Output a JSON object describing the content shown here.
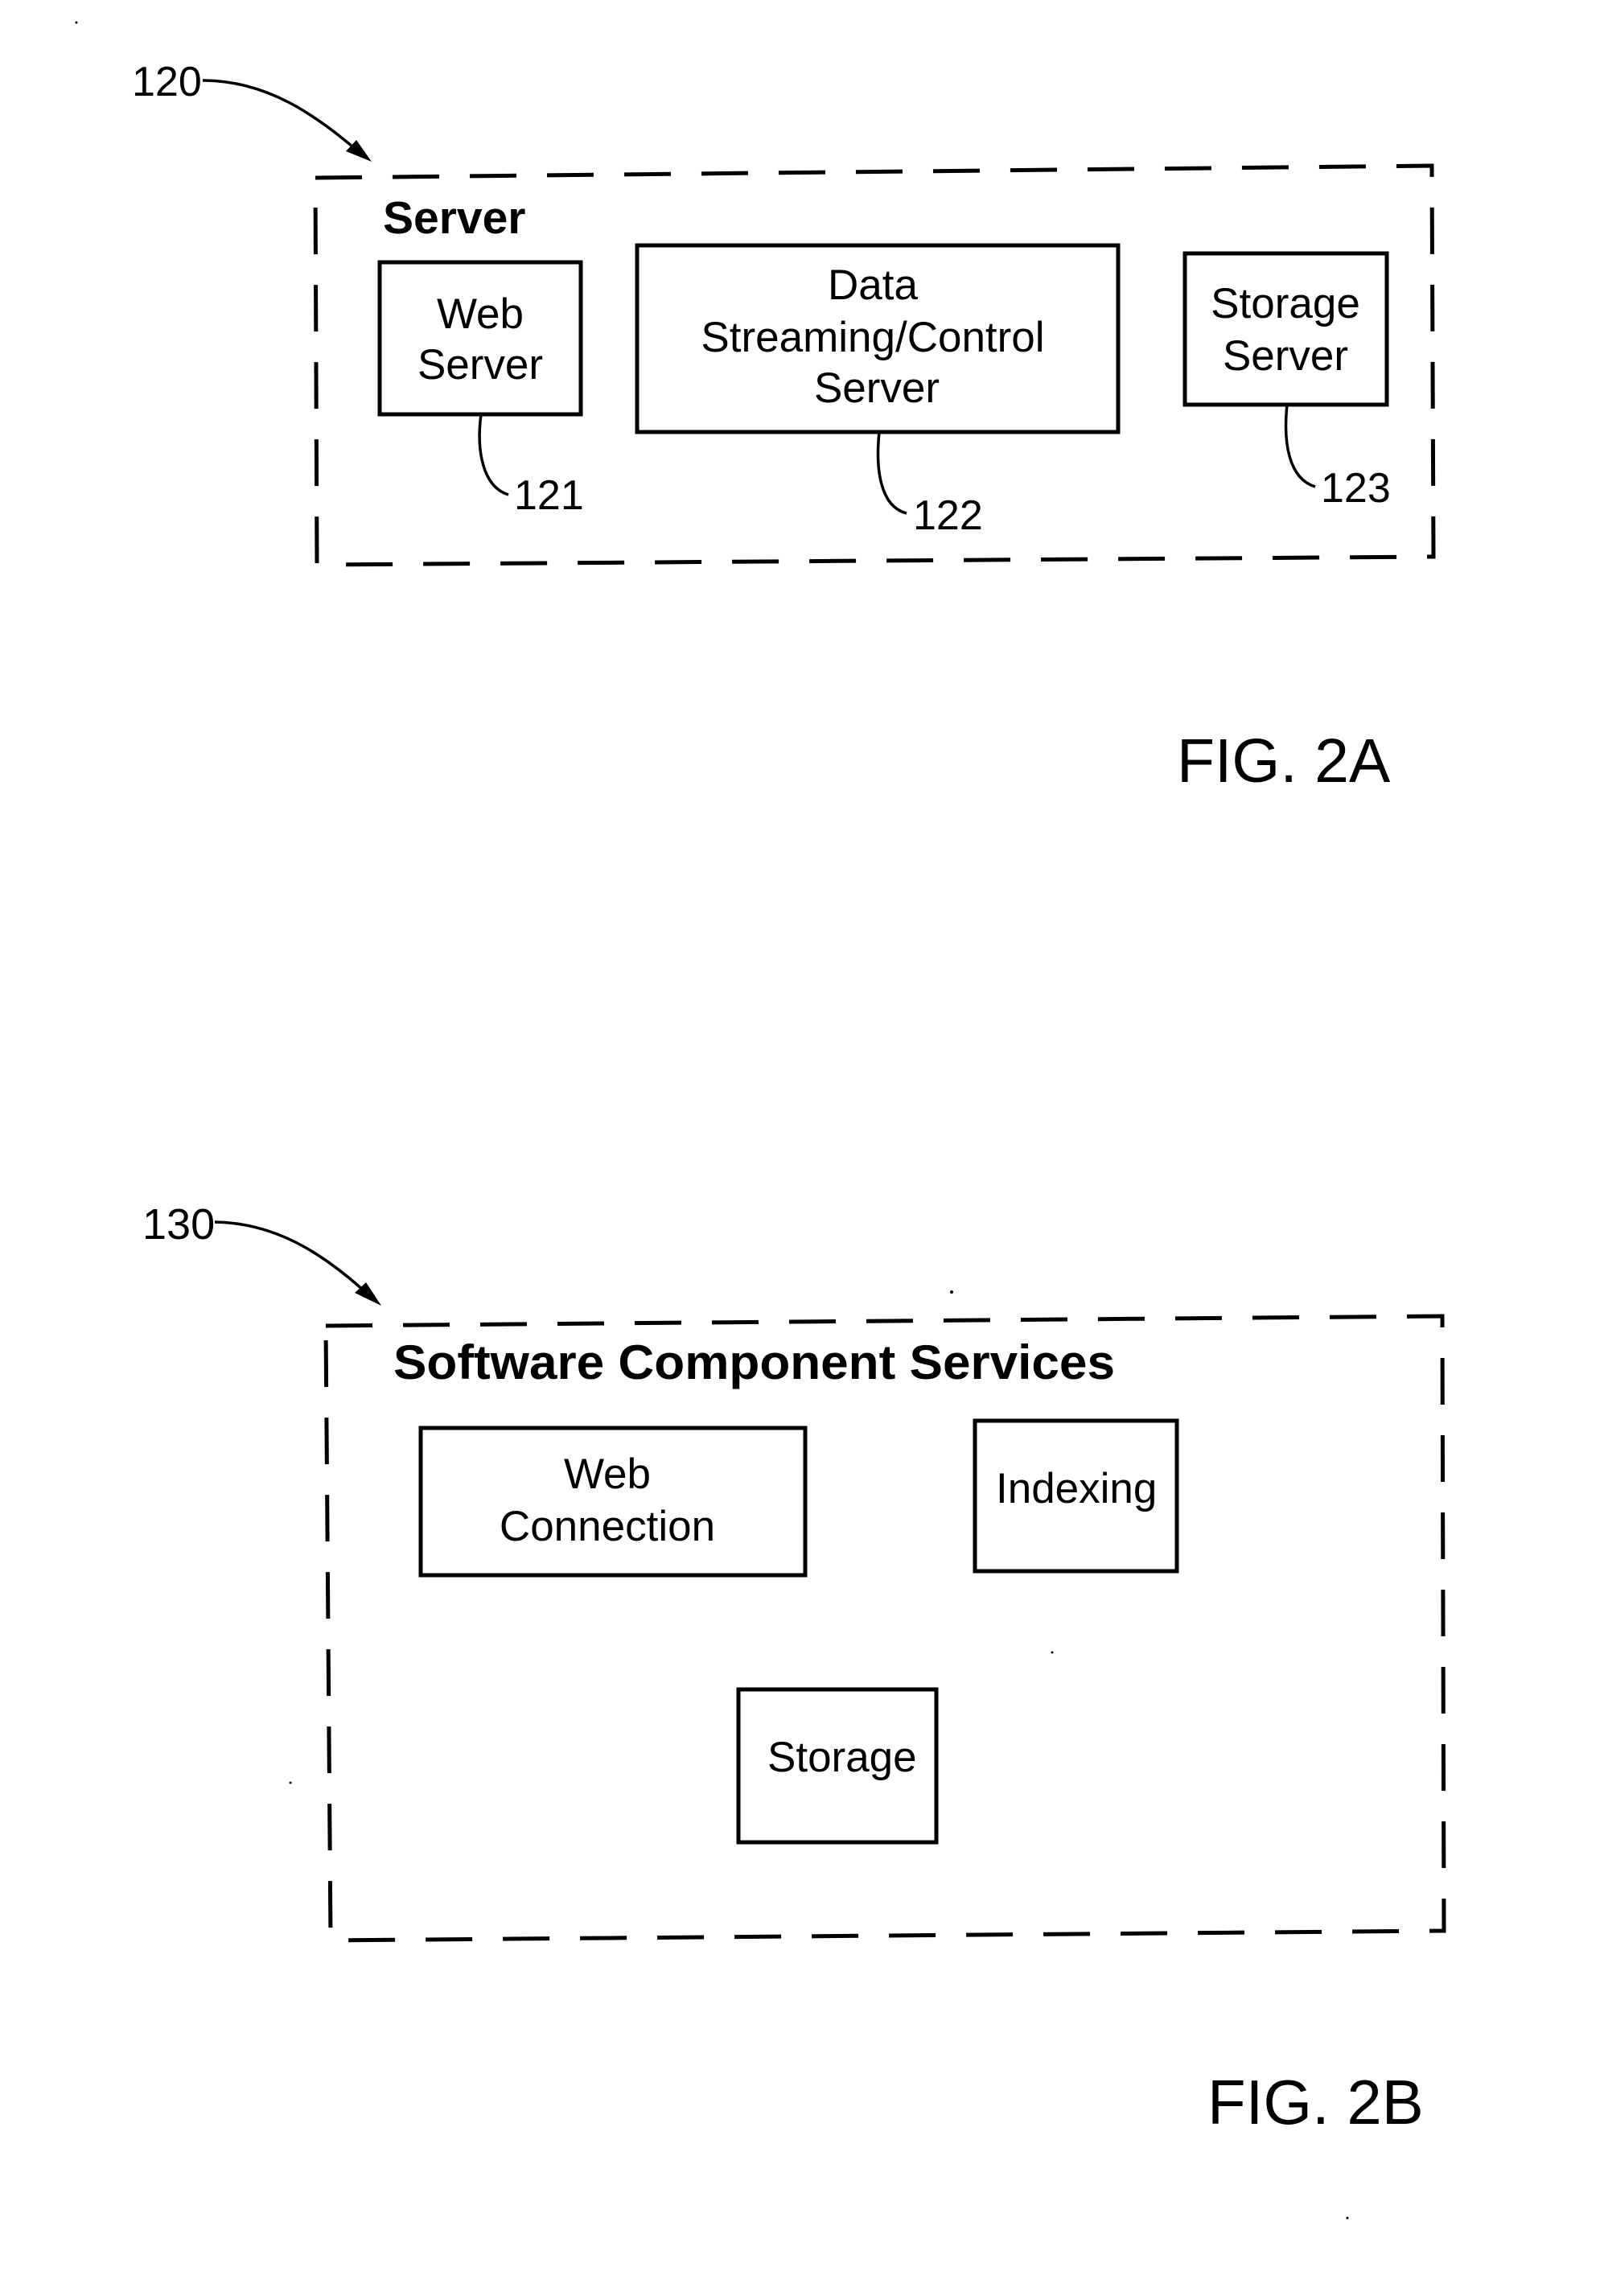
{
  "figures": [
    {
      "caption": "FIG. 2A",
      "reference": "120",
      "container_title": "Server",
      "components": [
        {
          "lines": [
            "Web",
            "Server"
          ],
          "reference": "121"
        },
        {
          "lines": [
            "Data",
            "Streaming/Control",
            "Server"
          ],
          "reference": "122"
        },
        {
          "lines": [
            "Storage",
            "Server"
          ],
          "reference": "123"
        }
      ]
    },
    {
      "caption": "FIG. 2B",
      "reference": "130",
      "container_title": "Software Component Services",
      "components": [
        {
          "lines": [
            "Web",
            "Connection"
          ]
        },
        {
          "lines": [
            "Indexing"
          ]
        },
        {
          "lines": [
            "Storage"
          ]
        }
      ]
    }
  ]
}
